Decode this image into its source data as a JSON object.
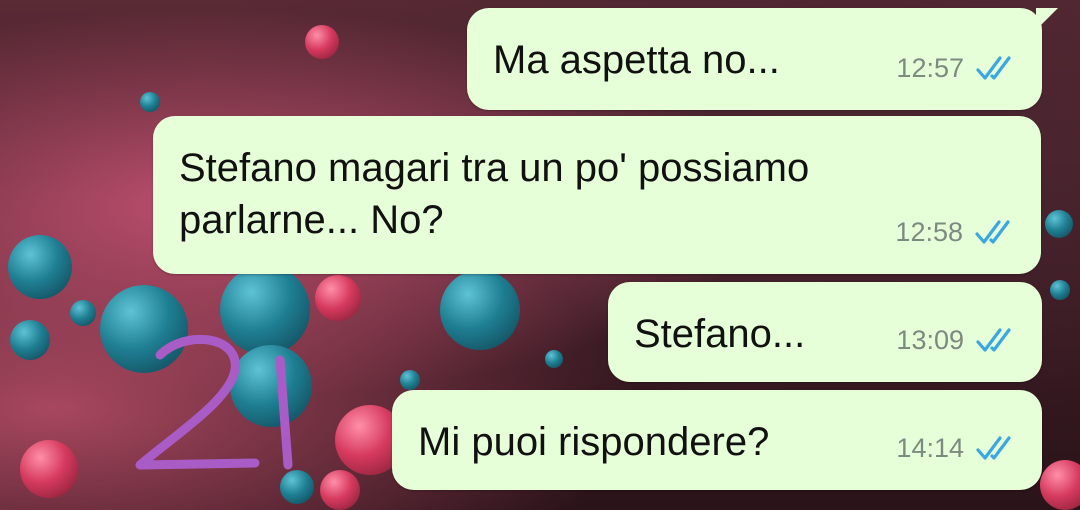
{
  "messages": [
    {
      "text": "Ma aspetta no...",
      "time": "12:57",
      "status": "read"
    },
    {
      "text": "Stefano magari tra un po' possiamo parlarne... No?",
      "time": "12:58",
      "status": "read"
    },
    {
      "text": "Stefano...",
      "time": "13:09",
      "status": "read"
    },
    {
      "text": "Mi puoi rispondere?",
      "time": "14:14",
      "status": "read"
    }
  ],
  "annotation": "21",
  "colors": {
    "bubble": "#e6ffd9",
    "read_checks": "#3aa7e0",
    "annotation": "#a95cc6"
  }
}
